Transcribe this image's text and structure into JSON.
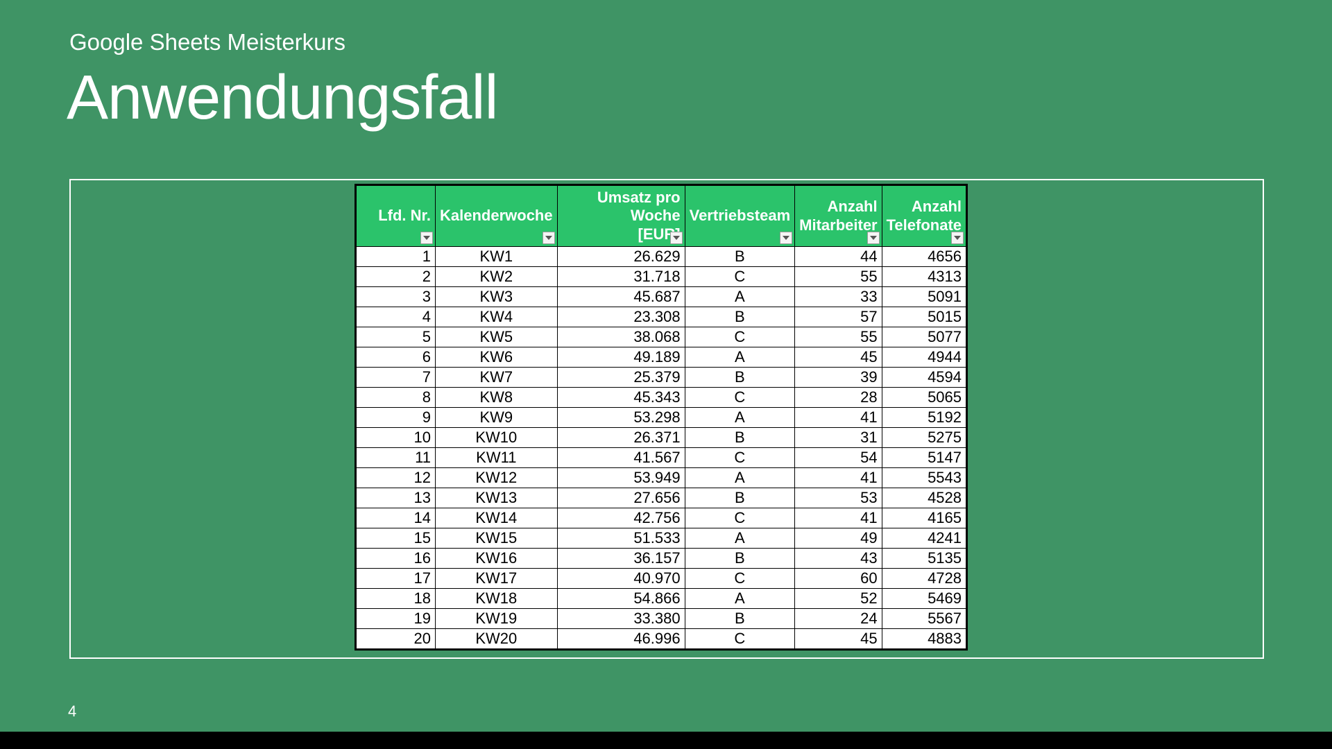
{
  "slide": {
    "subtitle": "Google Sheets Meisterkurs",
    "title": "Anwendungsfall",
    "page_number": "4"
  },
  "table": {
    "headers": {
      "nr": "Lfd. Nr.",
      "kw": "Kalenderwoche",
      "umsatz_line1": "Umsatz pro Woche",
      "umsatz_line2": "[EUR]",
      "team": "Vertriebsteam",
      "mit_line1": "Anzahl",
      "mit_line2": "Mitarbeiter",
      "tel_line1": "Anzahl",
      "tel_line2": "Telefonate"
    },
    "rows": [
      {
        "nr": "1",
        "kw": "KW1",
        "umsatz": "26.629",
        "team": "B",
        "mit": "44",
        "tel": "4656"
      },
      {
        "nr": "2",
        "kw": "KW2",
        "umsatz": "31.718",
        "team": "C",
        "mit": "55",
        "tel": "4313"
      },
      {
        "nr": "3",
        "kw": "KW3",
        "umsatz": "45.687",
        "team": "A",
        "mit": "33",
        "tel": "5091"
      },
      {
        "nr": "4",
        "kw": "KW4",
        "umsatz": "23.308",
        "team": "B",
        "mit": "57",
        "tel": "5015"
      },
      {
        "nr": "5",
        "kw": "KW5",
        "umsatz": "38.068",
        "team": "C",
        "mit": "55",
        "tel": "5077"
      },
      {
        "nr": "6",
        "kw": "KW6",
        "umsatz": "49.189",
        "team": "A",
        "mit": "45",
        "tel": "4944"
      },
      {
        "nr": "7",
        "kw": "KW7",
        "umsatz": "25.379",
        "team": "B",
        "mit": "39",
        "tel": "4594"
      },
      {
        "nr": "8",
        "kw": "KW8",
        "umsatz": "45.343",
        "team": "C",
        "mit": "28",
        "tel": "5065"
      },
      {
        "nr": "9",
        "kw": "KW9",
        "umsatz": "53.298",
        "team": "A",
        "mit": "41",
        "tel": "5192"
      },
      {
        "nr": "10",
        "kw": "KW10",
        "umsatz": "26.371",
        "team": "B",
        "mit": "31",
        "tel": "5275"
      },
      {
        "nr": "11",
        "kw": "KW11",
        "umsatz": "41.567",
        "team": "C",
        "mit": "54",
        "tel": "5147"
      },
      {
        "nr": "12",
        "kw": "KW12",
        "umsatz": "53.949",
        "team": "A",
        "mit": "41",
        "tel": "5543"
      },
      {
        "nr": "13",
        "kw": "KW13",
        "umsatz": "27.656",
        "team": "B",
        "mit": "53",
        "tel": "4528"
      },
      {
        "nr": "14",
        "kw": "KW14",
        "umsatz": "42.756",
        "team": "C",
        "mit": "41",
        "tel": "4165"
      },
      {
        "nr": "15",
        "kw": "KW15",
        "umsatz": "51.533",
        "team": "A",
        "mit": "49",
        "tel": "4241"
      },
      {
        "nr": "16",
        "kw": "KW16",
        "umsatz": "36.157",
        "team": "B",
        "mit": "43",
        "tel": "5135"
      },
      {
        "nr": "17",
        "kw": "KW17",
        "umsatz": "40.970",
        "team": "C",
        "mit": "60",
        "tel": "4728"
      },
      {
        "nr": "18",
        "kw": "KW18",
        "umsatz": "54.866",
        "team": "A",
        "mit": "52",
        "tel": "5469"
      },
      {
        "nr": "19",
        "kw": "KW19",
        "umsatz": "33.380",
        "team": "B",
        "mit": "24",
        "tel": "5567"
      },
      {
        "nr": "20",
        "kw": "KW20",
        "umsatz": "46.996",
        "team": "C",
        "mit": "45",
        "tel": "4883"
      }
    ]
  }
}
